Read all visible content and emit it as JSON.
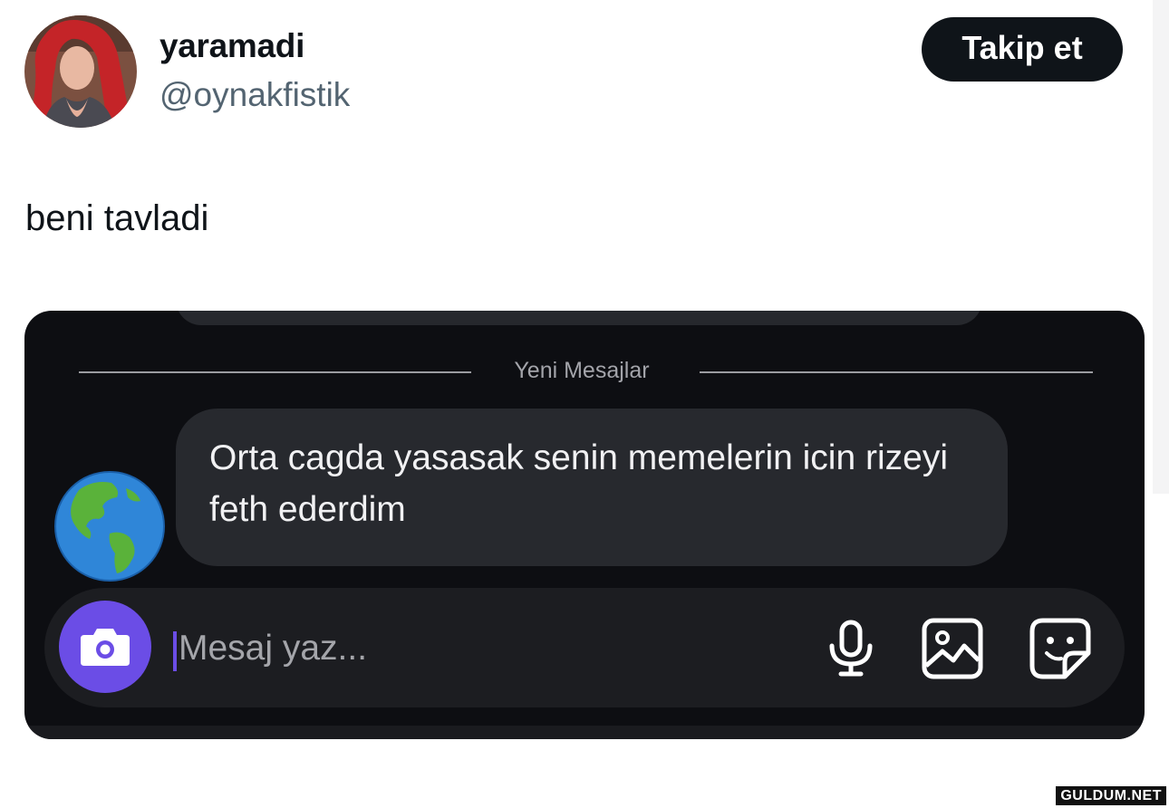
{
  "user": {
    "display_name": "yaramadi",
    "handle": "@oynakfistik",
    "avatar_icon": "profile-photo"
  },
  "follow_button": {
    "label": "Takip et"
  },
  "tweet": {
    "text": "beni tavladi"
  },
  "chat": {
    "divider_label": "Yeni Mesajlar",
    "sender_avatar_icon": "earth-globe-americas",
    "message": "Orta cagda yasasak senin memelerin icin rizeyi feth ederdim",
    "input": {
      "placeholder": "Mesaj yaz...",
      "camera_icon": "camera-icon",
      "mic_icon": "microphone-icon",
      "gallery_icon": "image-icon",
      "sticker_icon": "sticker-icon"
    },
    "colors": {
      "accent": "#6b4de6",
      "background": "#0d0e12",
      "bubble": "#27292e"
    }
  },
  "watermark": "GULDUM.NET"
}
